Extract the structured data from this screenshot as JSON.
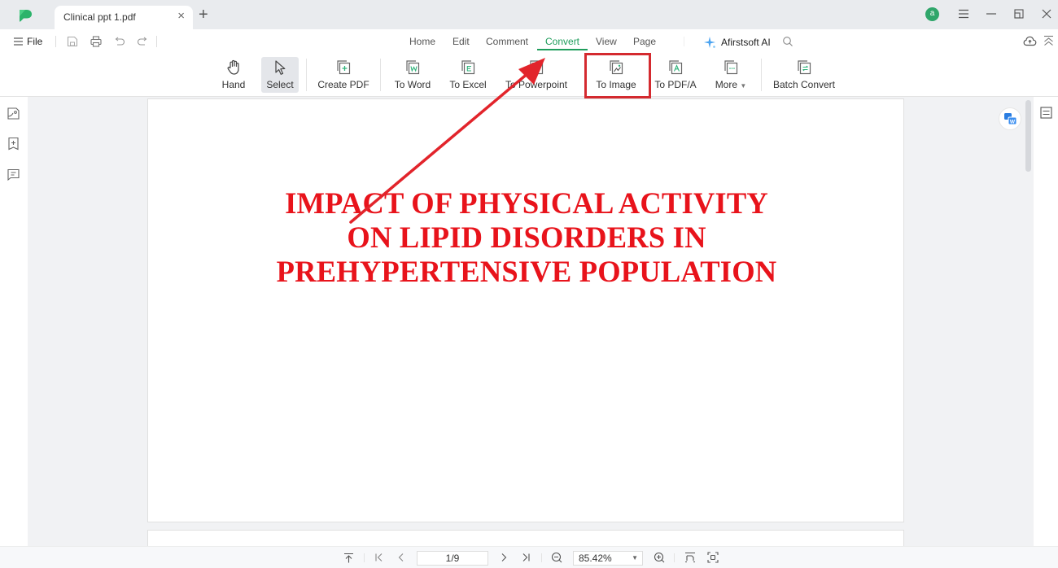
{
  "titlebar": {
    "tab_title": "Clinical ppt 1.pdf",
    "tab_close": "×",
    "new_tab": "+",
    "avatar_letter": "a",
    "accent_color": "#1f9d5c"
  },
  "menu": {
    "file_label": "File",
    "tabs": [
      {
        "label": "Home",
        "active": false
      },
      {
        "label": "Edit",
        "active": false
      },
      {
        "label": "Comment",
        "active": false
      },
      {
        "label": "Convert",
        "active": true
      },
      {
        "label": "View",
        "active": false
      },
      {
        "label": "Page",
        "active": false
      }
    ],
    "ai_label": "Afirstsoft AI"
  },
  "toolbar": {
    "tools": [
      {
        "label": "Hand",
        "icon": "hand-icon",
        "selected": false
      },
      {
        "label": "Select",
        "icon": "cursor-icon",
        "selected": true
      },
      {
        "label": "Create PDF",
        "icon": "create-pdf-icon",
        "selected": false
      },
      {
        "label": "To Word",
        "icon": "word-icon",
        "selected": false
      },
      {
        "label": "To Excel",
        "icon": "excel-icon",
        "selected": false
      },
      {
        "label": "To Powerpoint",
        "icon": "powerpoint-icon",
        "selected": false
      },
      {
        "label": "To Image",
        "icon": "image-icon",
        "selected": false,
        "highlighted": true
      },
      {
        "label": "To PDF/A",
        "icon": "pdfa-icon",
        "selected": false
      },
      {
        "label": "More",
        "icon": "more-icon",
        "selected": false,
        "has_dropdown": true
      },
      {
        "label": "Batch Convert",
        "icon": "batch-convert-icon",
        "selected": false
      }
    ]
  },
  "document": {
    "title_lines": [
      "IMPACT OF PHYSICAL ACTIVITY",
      "ON LIPID DISORDERS IN",
      "PREHYPERTENSIVE POPULATION"
    ],
    "title_color": "#e8131b"
  },
  "bottombar": {
    "page_indicator": "1/9",
    "zoom_level": "85.42%"
  },
  "annotation": {
    "highlight_target": "To Image",
    "color": "#d42a2f"
  }
}
